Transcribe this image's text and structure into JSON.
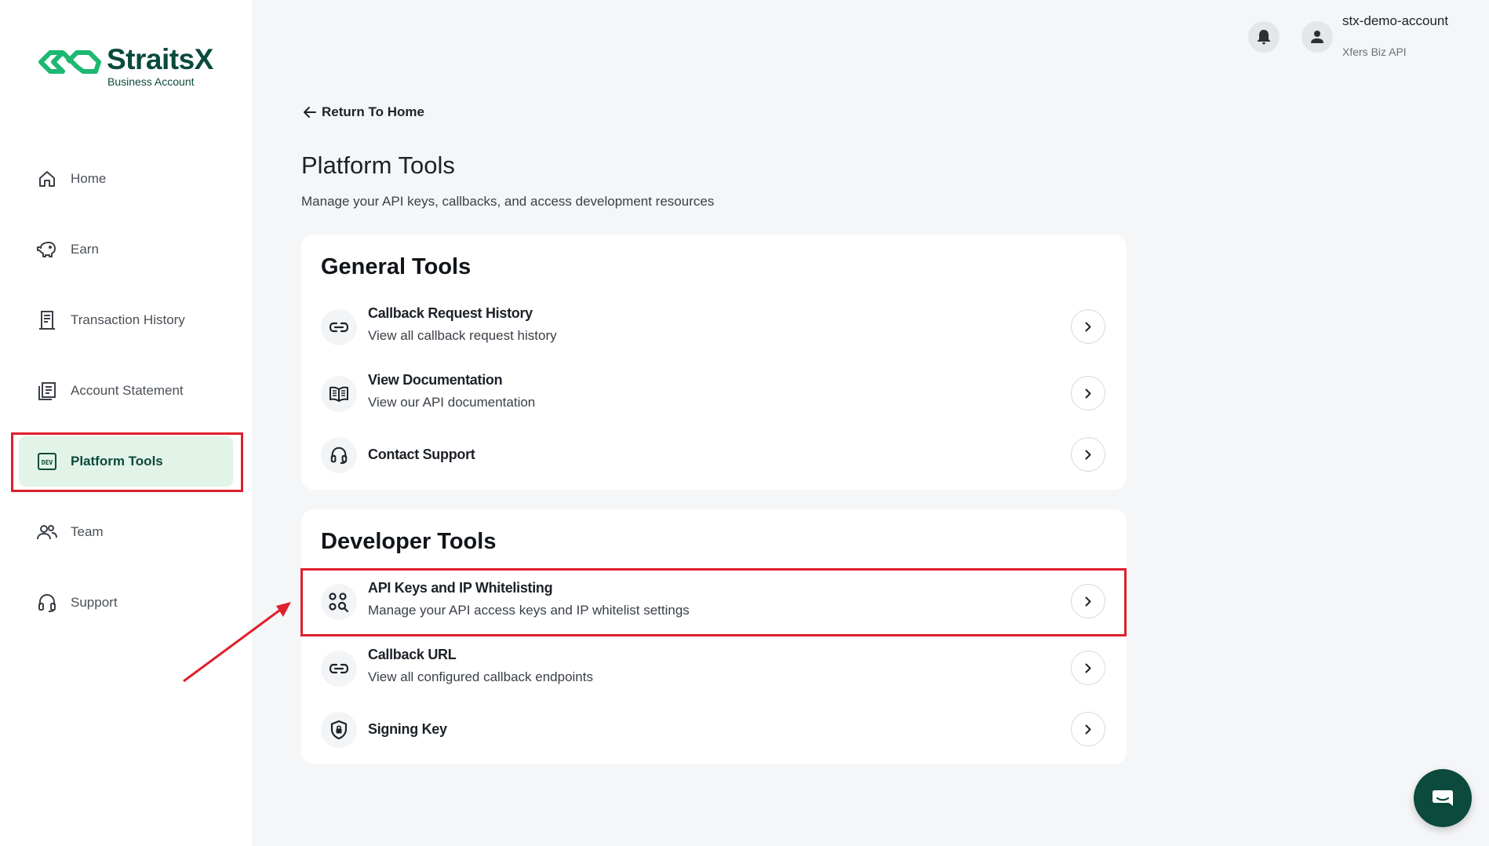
{
  "brand": {
    "name": "StraitsX",
    "subtitle": "Business Account",
    "color": "#0a4a3c",
    "accent": "#1db871"
  },
  "sidebar": {
    "items": [
      {
        "label": "Home",
        "icon": "home-icon"
      },
      {
        "label": "Earn",
        "icon": "piggy-bank-icon"
      },
      {
        "label": "Transaction History",
        "icon": "receipt-icon"
      },
      {
        "label": "Account Statement",
        "icon": "statement-icon"
      },
      {
        "label": "Platform Tools",
        "icon": "dev-icon",
        "active": true
      },
      {
        "label": "Team",
        "icon": "team-icon"
      },
      {
        "label": "Support",
        "icon": "headset-icon"
      }
    ]
  },
  "header": {
    "account_name": "stx-demo-account",
    "account_sub": "Xfers Biz API"
  },
  "main": {
    "back_label": "Return To Home",
    "title": "Platform Tools",
    "subtitle": "Manage your API keys, callbacks, and access development resources",
    "general": {
      "title": "General Tools",
      "rows": [
        {
          "title": "Callback Request History",
          "desc": "View all callback request history",
          "icon": "link-icon"
        },
        {
          "title": "View Documentation",
          "desc": "View our API documentation",
          "icon": "book-icon"
        },
        {
          "title": "Contact Support",
          "desc": "",
          "icon": "headset-icon"
        }
      ]
    },
    "developer": {
      "title": "Developer Tools",
      "rows": [
        {
          "title": "API Keys and IP Whitelisting",
          "desc": "Manage your API access keys and IP whitelist settings",
          "icon": "key-search-icon"
        },
        {
          "title": "Callback URL",
          "desc": "View all configured callback endpoints",
          "icon": "link-icon"
        },
        {
          "title": "Signing Key",
          "desc": "",
          "icon": "shield-lock-icon"
        }
      ]
    }
  },
  "annotation_color": "#e0202a",
  "chat_icon": "chat-icon"
}
